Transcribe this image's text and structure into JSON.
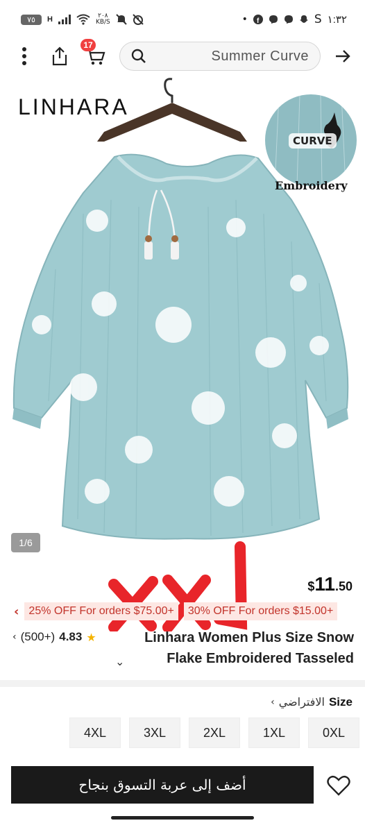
{
  "status_bar": {
    "battery": "٧٥",
    "network": "H",
    "speed_value": "٢٠٨",
    "speed_unit": "KB/S",
    "time": "١:٣٢",
    "left_icons": [
      "battery-icon",
      "signal-icon",
      "wifi-icon",
      "mute-icon",
      "alarm-icon"
    ],
    "right_icons": [
      "facebook-icon",
      "messenger-icon",
      "messenger-icon",
      "snapchat-icon",
      "s-icon"
    ]
  },
  "top_nav": {
    "cart_count": "17",
    "search_text": "Summer Curve"
  },
  "product_image": {
    "brand": "LINHARA",
    "badge_label": "CURVE",
    "embroidery_label": "Embroidery",
    "counter": "1/6",
    "background_color": "#ffffff",
    "shirt_color": "#9fcbd0"
  },
  "overlay": {
    "text": "XXL",
    "color": "#e8252a"
  },
  "product": {
    "currency": "$",
    "price_whole": "11",
    "price_fraction": ".50",
    "promos": [
      "25% OFF For orders $75.00+",
      "30% OFF For orders $15.00+"
    ],
    "reviews_count": "(500+)",
    "rating": "4.83",
    "title_line1": "Linhara Women Plus Size Snow",
    "title_line2": "Flake Embroidered Tasseled"
  },
  "size": {
    "label": "Size",
    "default_label": "الافتراضي",
    "options": [
      "4XL",
      "3XL",
      "2XL",
      "1XL",
      "0XL"
    ]
  },
  "bottom_bar": {
    "add_to_cart": "أضف إلى عربة التسوق بنجاح"
  },
  "colors": {
    "accent_red": "#c2342b",
    "promo_bg": "#fde7e3",
    "button_dark": "#1a1a1a",
    "star": "#f5b400"
  }
}
